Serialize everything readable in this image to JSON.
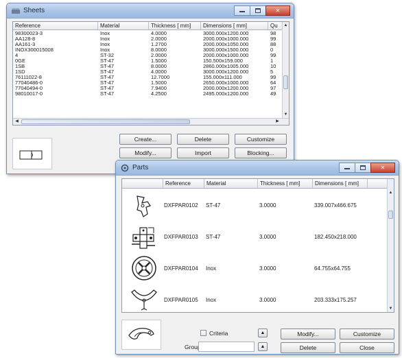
{
  "sheets_window": {
    "title": "Sheets",
    "columns": [
      "Reference",
      "Material",
      "Thickness [ mm]",
      "Dimensions [ mm]",
      "Qu"
    ],
    "rows": [
      [
        "98300023-3",
        "Inox",
        "4.0000",
        "3000.000x1200.000",
        "98"
      ],
      [
        "AA128-8",
        "Inox",
        "2.0000",
        "2000.000x1000.000",
        "99"
      ],
      [
        "AA161-3",
        "Inox",
        "1.2700",
        "2000.000x1050.000",
        "88"
      ],
      [
        "INOX300015008",
        "Inox",
        "8.0000",
        "3000.000x1500.000",
        "0"
      ],
      [
        "4",
        "ST-32",
        "2.0000",
        "2000.000x1000.000",
        "99"
      ],
      [
        "0GE",
        "ST-47",
        "1.5000",
        "150.500x159.000",
        "1"
      ],
      [
        "1SB",
        "ST-47",
        "8.0000",
        "2860.000x1005.000",
        "10"
      ],
      [
        "1SD",
        "ST-47",
        "4.0000",
        "3000.000x1200.000",
        "5"
      ],
      [
        "76111022-8",
        "ST-47",
        "12.7000",
        "155.000x111.000",
        "99"
      ],
      [
        "77040486-0",
        "ST-47",
        "1.5000",
        "2650.000x1000.000",
        "64"
      ],
      [
        "77040494-0",
        "ST-47",
        "7.9400",
        "2000.000x1200.000",
        "97"
      ],
      [
        "98010017-0",
        "ST-47",
        "4.2500",
        "2495.000x1200.000",
        "49"
      ]
    ],
    "buttons": {
      "create": "Create...",
      "delete": "Delete",
      "customize": "Customize",
      "modify": "Modify...",
      "import": "Import",
      "blocking": "Blocking..."
    }
  },
  "parts_window": {
    "title": "Parts",
    "columns": [
      "Reference",
      "Material",
      "Thickness [ mm]",
      "Dimensions [ mm]"
    ],
    "rows": [
      {
        "reference": "DXFPAR0102",
        "material": "ST-47",
        "thickness": "3.0000",
        "dimensions": "339.007x466.675",
        "icon": "bracket-part-icon"
      },
      {
        "reference": "DXFPAR0103",
        "material": "ST-47",
        "thickness": "3.0000",
        "dimensions": "182.450x218.000",
        "icon": "complex-part-icon"
      },
      {
        "reference": "DXFPAR0104",
        "material": "Inox",
        "thickness": "3.0000",
        "dimensions": "64.755x64.755",
        "icon": "round-part-icon"
      },
      {
        "reference": "DXFPAR0105",
        "material": "Inox",
        "thickness": "3.0000",
        "dimensions": "203.333x175.257",
        "icon": "arc-part-icon"
      }
    ],
    "criteria_label": "Criteria",
    "group_label": "Group",
    "buttons": {
      "modify": "Modify...",
      "customize": "Customize",
      "delete": "Delete",
      "close": "Close"
    }
  },
  "colors": {
    "titlebar": "#b0c9e8",
    "close_button": "#c9412d"
  }
}
